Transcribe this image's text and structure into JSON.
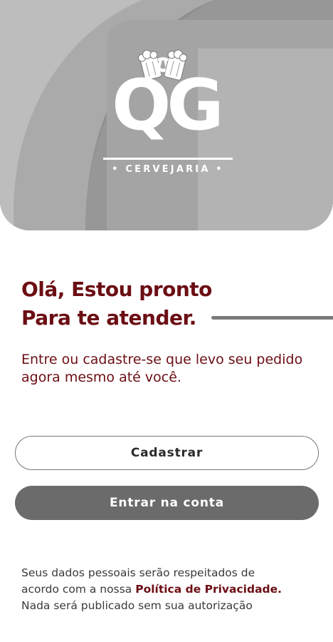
{
  "logo": {
    "wordmark": "QG",
    "subtitle": "• CERVEJARIA •",
    "icon": "beer-mugs-icon"
  },
  "welcome": {
    "line1": "Olá, Estou pronto",
    "line2": "Para te atender."
  },
  "intro": "Entre ou cadastre-se que levo seu pedido agora mesmo até você.",
  "buttons": {
    "register": "Cadastrar",
    "login": "Entrar na conta"
  },
  "privacy": {
    "line1": "Seus dados pessoais serão respeitados de",
    "line2_prefix": "acordo com a nossa ",
    "link": "Política de Privacidade.",
    "line3": "Nada será publicado sem sua autorização"
  },
  "colors": {
    "accent": "#6b0e14",
    "hero_bg": "#9a9a9a",
    "button_dark": "#6b6b6b"
  }
}
